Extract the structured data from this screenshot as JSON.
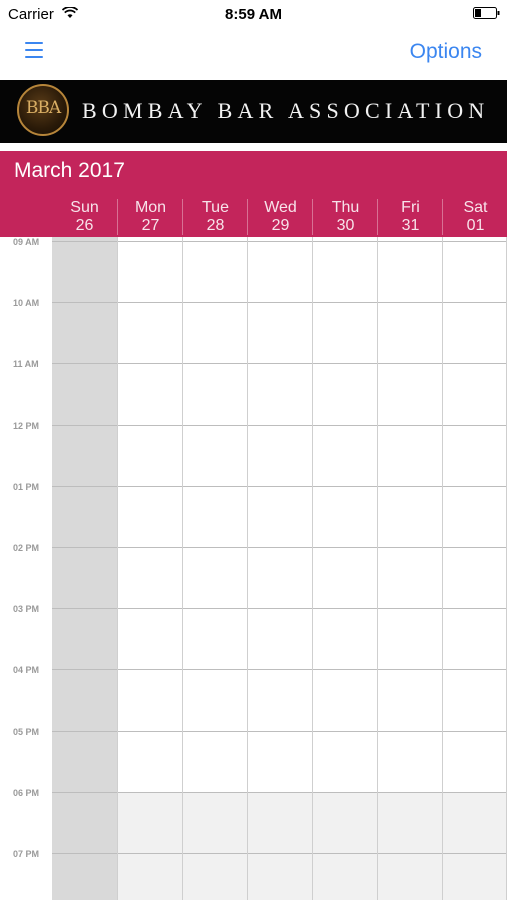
{
  "status_bar": {
    "carrier": "Carrier",
    "time": "8:59 AM"
  },
  "nav": {
    "options_label": "Options"
  },
  "banner": {
    "logo_text": "BBA",
    "title": "BOMBAY BAR ASSOCIATION"
  },
  "calendar": {
    "month_title": "March 2017",
    "days": [
      {
        "name": "Sun",
        "date": "26"
      },
      {
        "name": "Mon",
        "date": "27"
      },
      {
        "name": "Tue",
        "date": "28"
      },
      {
        "name": "Wed",
        "date": "29"
      },
      {
        "name": "Thu",
        "date": "30"
      },
      {
        "name": "Fri",
        "date": "31"
      },
      {
        "name": "Sat",
        "date": "01"
      }
    ],
    "hours": [
      "09 AM",
      "10 AM",
      "11 AM",
      "12 PM",
      "01 PM",
      "02 PM",
      "03 PM",
      "04 PM",
      "05 PM",
      "06 PM",
      "07 PM"
    ]
  },
  "colors": {
    "accent": "#c3255b",
    "link": "#3b86f0",
    "banner": "#050505"
  }
}
